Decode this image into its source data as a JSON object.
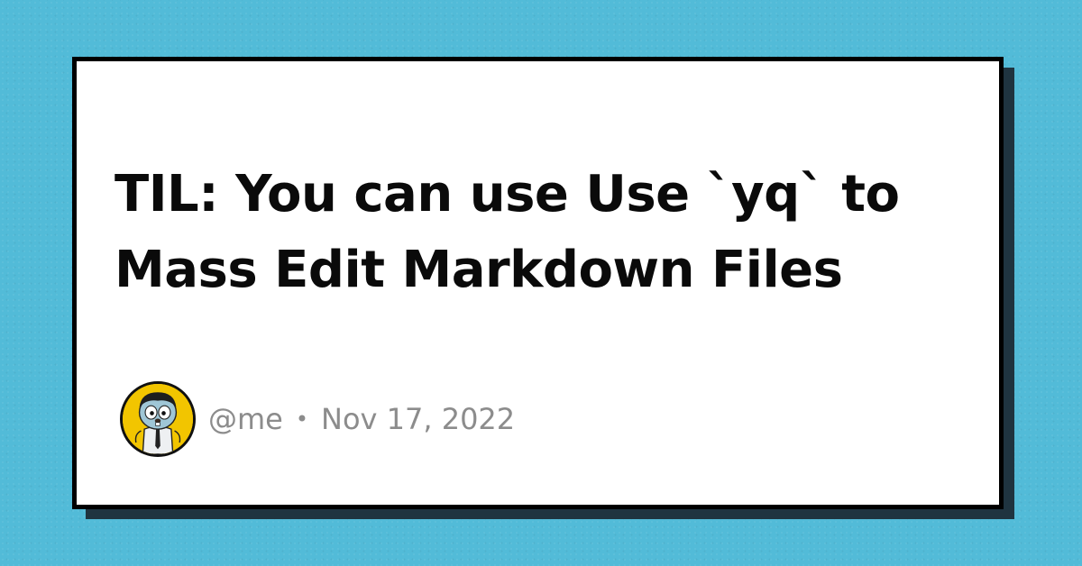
{
  "post": {
    "title": "TIL: You can use Use `yq` to Mass Edit Markdown Files",
    "author": "@me",
    "separator": "•",
    "date": "Nov 17, 2022"
  },
  "icons": {
    "avatar": "cartoon-gopher-avatar-icon"
  },
  "colors": {
    "background": "#52bbd8",
    "card": "#ffffff",
    "card_border": "#000000",
    "card_shadow": "#1f3440",
    "title_text": "#0a0a0a",
    "meta_text": "#8c8c8c",
    "avatar_bg": "#f2c500"
  }
}
